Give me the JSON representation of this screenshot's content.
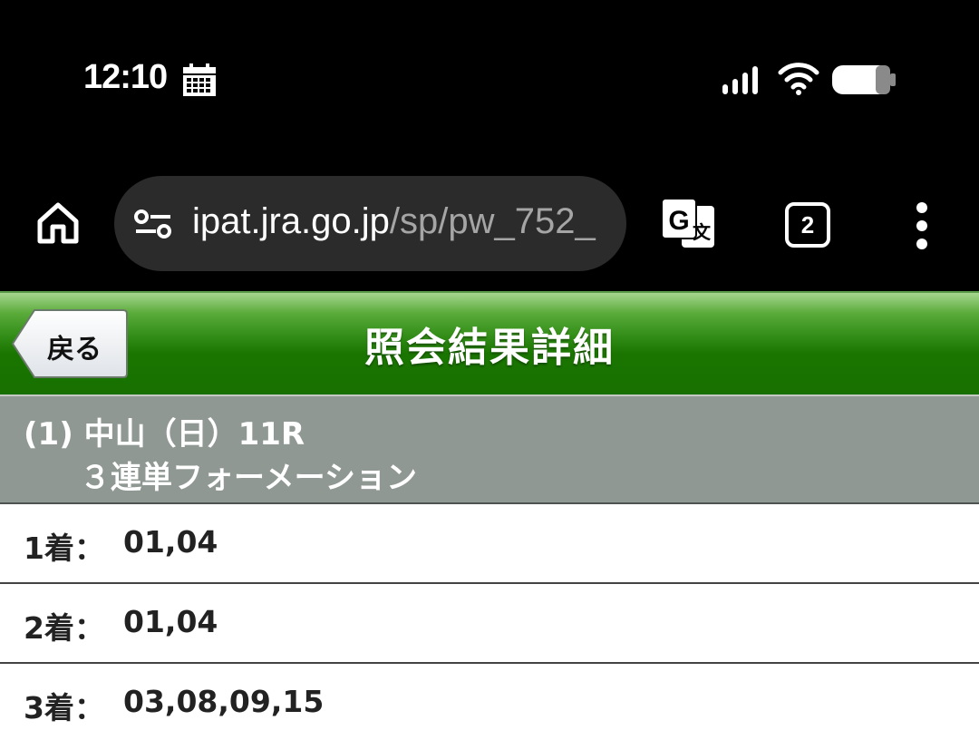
{
  "status_bar": {
    "time": "12:10"
  },
  "browser": {
    "url_host": "ipat.jra.go.jp",
    "url_path": "/sp/pw_752_",
    "tab_count": "2"
  },
  "header": {
    "back_label": "戻る",
    "title": "照会結果詳細"
  },
  "race": {
    "line1": "(1) 中山（日）11R",
    "line2": "３連単フォーメーション"
  },
  "results": [
    {
      "label": "1着：",
      "value": "01,04"
    },
    {
      "label": "2着：",
      "value": "01,04"
    },
    {
      "label": "3着：",
      "value": "03,08,09,15"
    }
  ],
  "colors": {
    "header_green": "#177000",
    "race_info_gray": "#909893",
    "url_pill": "#2b2b2b"
  },
  "icons": [
    "calendar-icon",
    "signal-icon",
    "wifi-icon",
    "battery-icon",
    "home-icon",
    "site-settings-icon",
    "translate-icon",
    "more-vert-icon"
  ]
}
